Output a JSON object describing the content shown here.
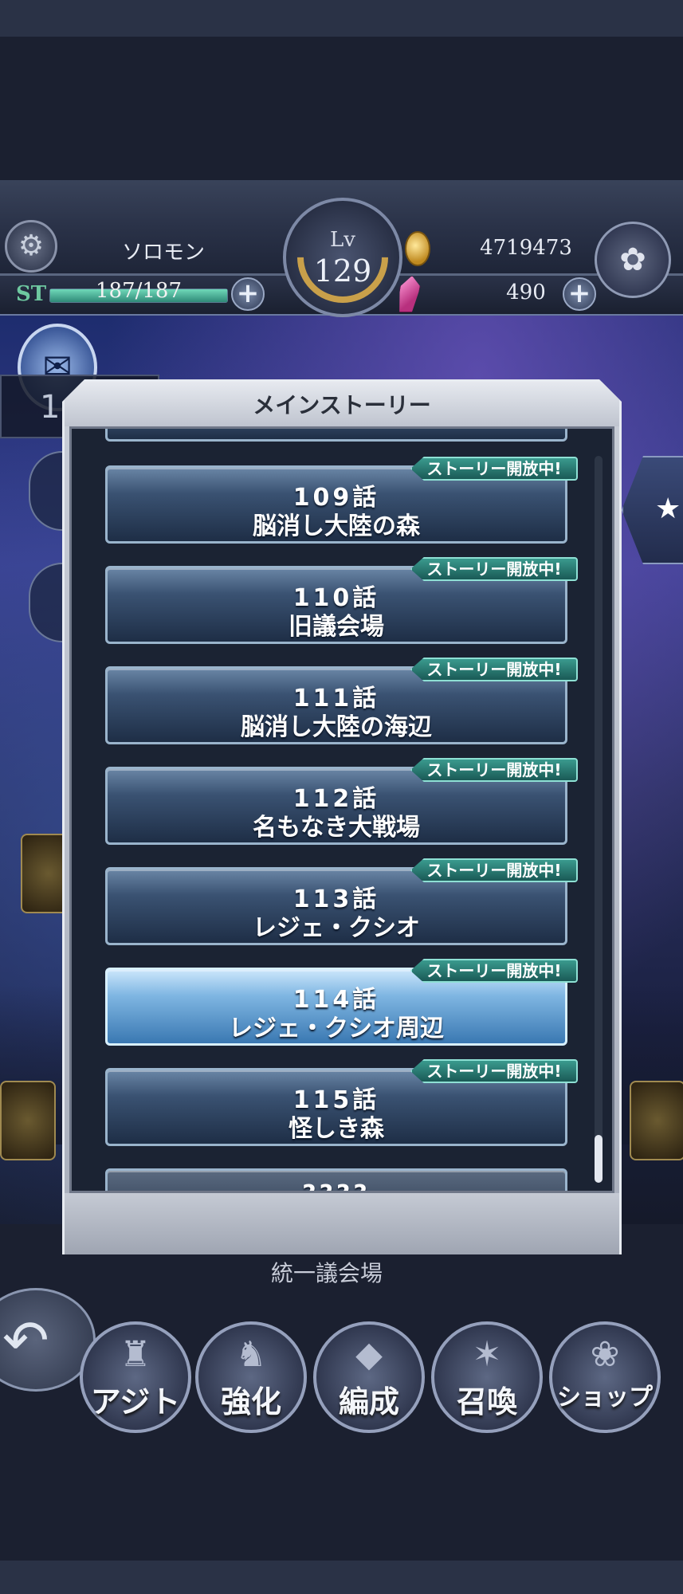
{
  "header": {
    "player_name": "ソロモン",
    "st_label": "ST",
    "st_value": "187/187",
    "st_fraction": 1.0,
    "level_label": "Lv",
    "level_value": "129",
    "gold": "4719473",
    "gems": "490",
    "plus_label": "+"
  },
  "dialog": {
    "title": "メインストーリー",
    "open_badge": "ストーリー開放中!",
    "chapters": [
      {
        "num": "109話",
        "name": "脳消し大陸の森",
        "open": true,
        "selected": false
      },
      {
        "num": "110話",
        "name": "旧議会場",
        "open": true,
        "selected": false
      },
      {
        "num": "111話",
        "name": "脳消し大陸の海辺",
        "open": true,
        "selected": false
      },
      {
        "num": "112話",
        "name": "名もなき大戦場",
        "open": true,
        "selected": false
      },
      {
        "num": "113話",
        "name": "レジェ・クシオ",
        "open": true,
        "selected": false
      },
      {
        "num": "114話",
        "name": "レジェ・クシオ周辺",
        "open": true,
        "selected": true
      },
      {
        "num": "115話",
        "name": "怪しき森",
        "open": true,
        "selected": false
      },
      {
        "num": "????",
        "name": "",
        "open": false,
        "selected": false
      }
    ]
  },
  "background": {
    "peek_label": "統一議会場"
  },
  "nav": {
    "items": [
      {
        "label": "アジト",
        "icon": "bottle-icon"
      },
      {
        "label": "強化",
        "icon": "warrior-icon"
      },
      {
        "label": "編成",
        "icon": "gem-icon"
      },
      {
        "label": "召喚",
        "icon": "magic-circle-icon"
      },
      {
        "label": "ショップ",
        "icon": "shop-bag-icon"
      }
    ]
  },
  "colors": {
    "accent_open_badge": "#2a7a70",
    "selected_chapter": "#7fb6e2"
  }
}
